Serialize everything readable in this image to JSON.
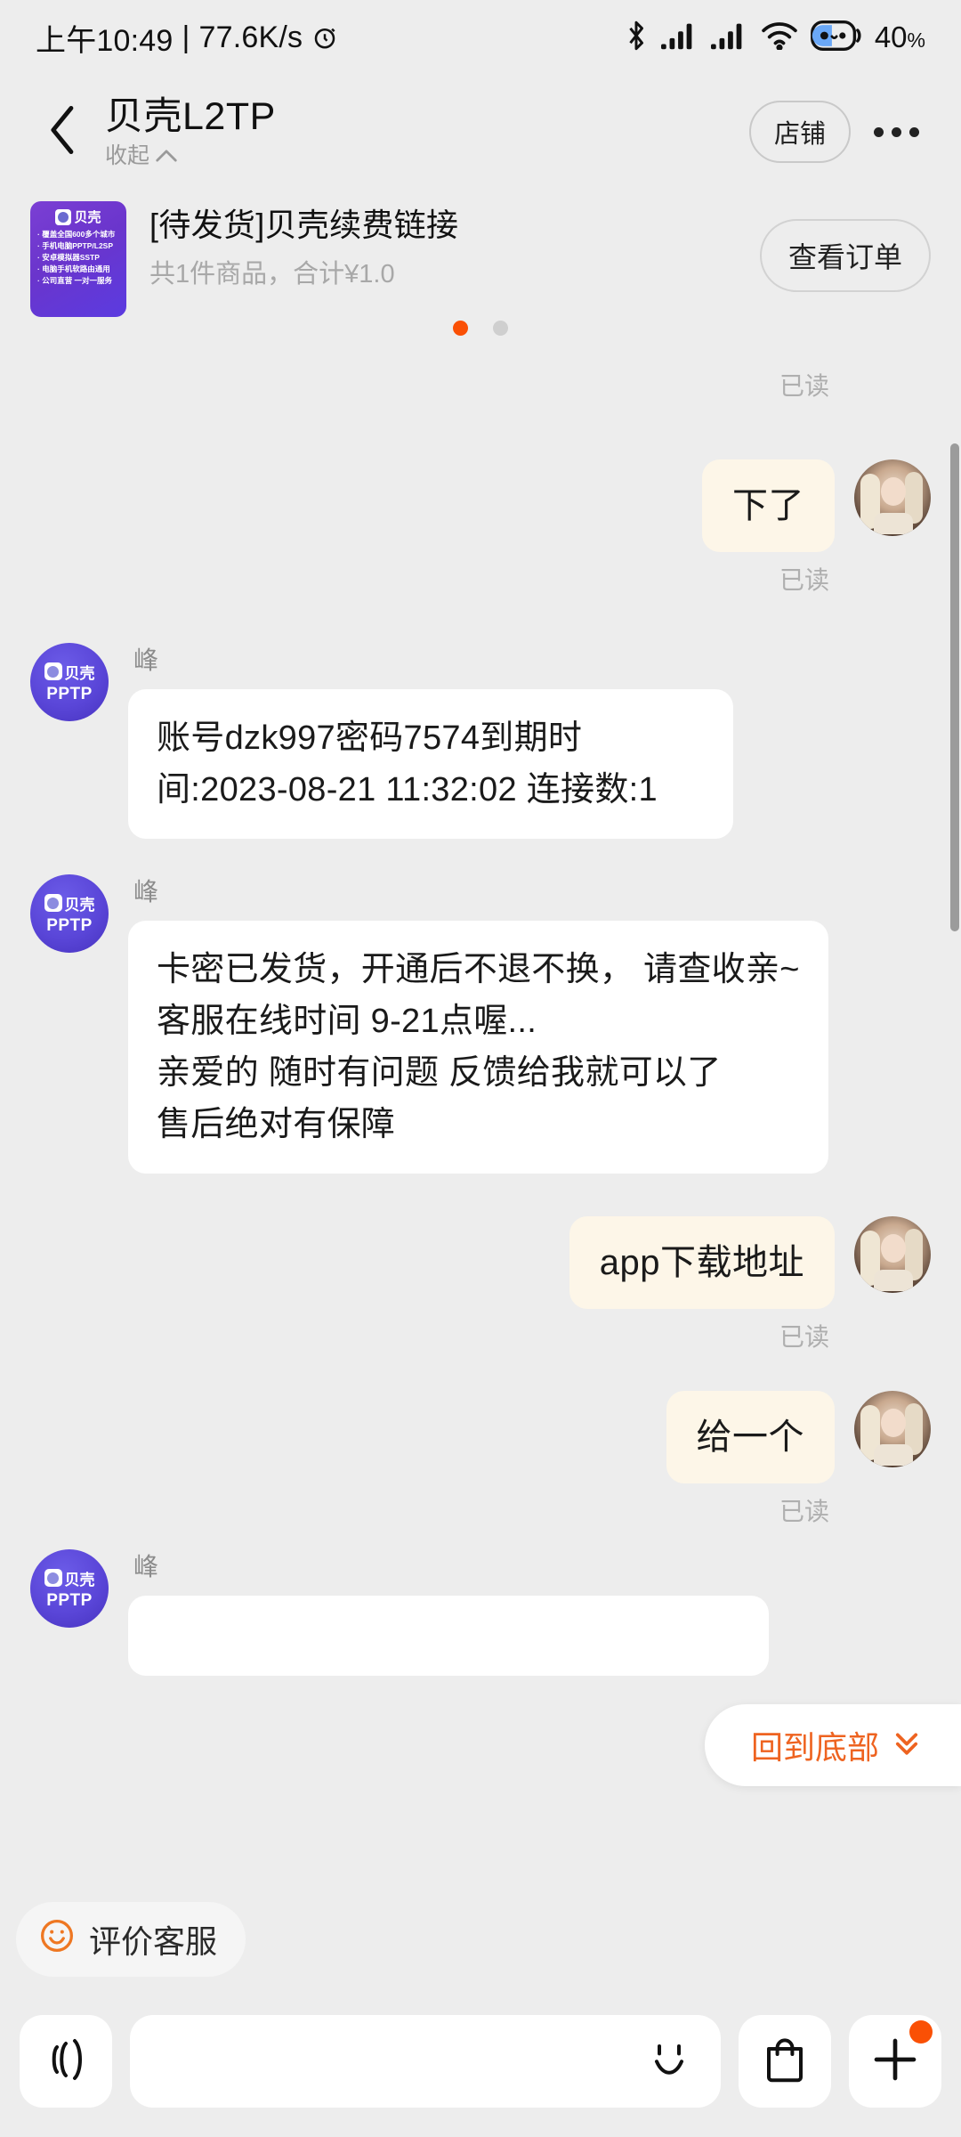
{
  "status_bar": {
    "time": "上午10:49",
    "separator": "|",
    "net_speed": "77.6K/s",
    "alarm_icon": "alarm-clock-icon",
    "bluetooth_icon": "bluetooth-icon",
    "signal1_icon": "cellular-signal-icon",
    "signal2_icon": "cellular-signal-icon",
    "wifi_icon": "wifi-icon",
    "battery_icon": "battery-icon",
    "battery_level": "40",
    "battery_unit": "%"
  },
  "header": {
    "back_icon": "chevron-left-icon",
    "title": "贝壳L2TP",
    "subtitle": "收起",
    "subtitle_icon": "chevron-up-icon",
    "shop_button": "店铺",
    "more_icon": "ellipsis-icon"
  },
  "order_card": {
    "thumbnail": {
      "brand": "贝壳",
      "lines": [
        "· 覆盖全国600多个城市",
        "· 手机电脑PPTP/L2SP",
        "· 安卓模拟器SSTP",
        "· 电脑手机软路由通用",
        "· 公司直营 一对一服务"
      ]
    },
    "title": "[待发货]贝壳续费链接",
    "subtitle": "共1件商品，合计¥1.0",
    "view_order_button": "查看订单",
    "pager": {
      "total": 2,
      "active_index": 0,
      "active_color": "#FA5005",
      "inactive_color": "#CFCFCF"
    }
  },
  "chat": {
    "read_label": "已读",
    "seller": {
      "name": "峰",
      "avatar_brand": "贝壳",
      "avatar_sub": "PPTP"
    },
    "messages": [
      {
        "id": "m0",
        "side": "out",
        "text": "",
        "read": "已读",
        "placeholder_only": true
      },
      {
        "id": "m1",
        "side": "out",
        "text": "下了",
        "read": "已读"
      },
      {
        "id": "m2",
        "side": "in",
        "sender": "峰",
        "text": "账号dzk997密码7574到期时间:2023-08-21 11:32:02 连接数:1"
      },
      {
        "id": "m3",
        "side": "in",
        "sender": "峰",
        "text": "卡密已发货，开通后不退不换， 请查收亲~\n客服在线时间 9-21点喔...\n亲爱的 随时有问题 反馈给我就可以了\n售后绝对有保障"
      },
      {
        "id": "m4",
        "side": "out",
        "text": "app下载地址",
        "read": "已读"
      },
      {
        "id": "m5",
        "side": "out",
        "text": "给一个",
        "read": "已读"
      },
      {
        "id": "m6",
        "side": "in",
        "sender": "峰",
        "text": ""
      }
    ]
  },
  "to_bottom": {
    "label": "回到底部",
    "icon": "double-chevron-down-icon",
    "color": "#EE6320"
  },
  "eval_chip": {
    "label": "评价客服",
    "icon": "smiley-face-icon",
    "color": "#EE7722"
  },
  "input_bar": {
    "voice_icon": "voice-wave-icon",
    "input_value": "",
    "input_placeholder": "",
    "emoji_icon": "smiley-icon",
    "shop_bag_icon": "shopping-bag-icon",
    "plus_icon": "plus-icon",
    "plus_badge": true
  },
  "colors": {
    "background": "#EDEDED",
    "bubble_out": "#FDF6E8",
    "bubble_in": "#FFFFFF",
    "accent_orange": "#FA5005",
    "seller_avatar": "#5A46D8",
    "scrollbar": "#9B9B9B"
  }
}
